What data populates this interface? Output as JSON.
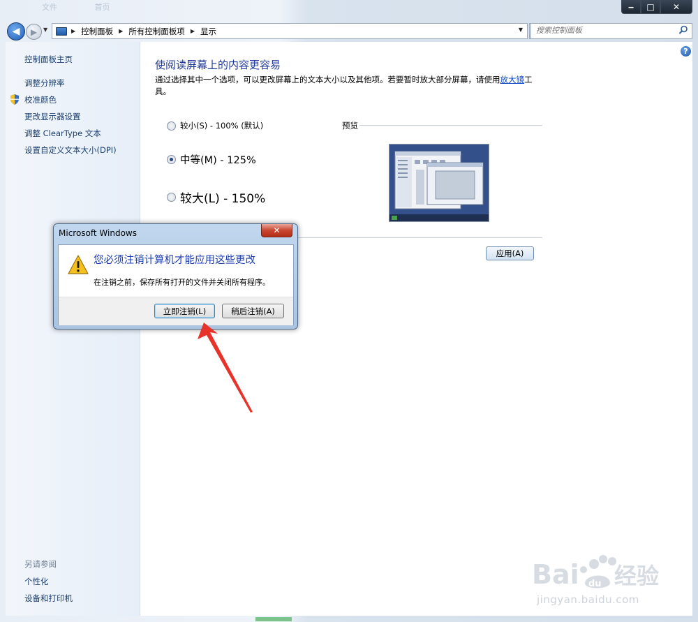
{
  "titlebar": {
    "faded_tabs": [
      "文件",
      "首页"
    ],
    "minimize": "‒",
    "maximize": "□",
    "close": "✕"
  },
  "nav": {
    "back_icon": "arrow-left-icon",
    "forward_icon": "arrow-right-icon",
    "breadcrumb": [
      "控制面板",
      "所有控制面板项",
      "显示"
    ],
    "search_placeholder": "搜索控制面板"
  },
  "sidebar": {
    "home": "控制面板主页",
    "items": [
      "调整分辨率",
      "校准颜色",
      "更改显示器设置",
      "调整 ClearType 文本",
      "设置自定义文本大小(DPI)"
    ],
    "see_also_title": "另请参阅",
    "see_also": [
      "个性化",
      "设备和打印机"
    ]
  },
  "main": {
    "heading": "使阅读屏幕上的内容更容易",
    "description_before": "通过选择其中一个选项，可以更改屏幕上的文本大小以及其他项。若要暂时放大部分屏幕，请使用",
    "description_link": "放大镜",
    "description_after": "工具。",
    "options": [
      {
        "label": "较小(S) - 100% (默认)",
        "checked": false
      },
      {
        "label": "中等(M) - 125%",
        "checked": true
      },
      {
        "label": "较大(L) - 150%",
        "checked": false
      }
    ],
    "preview_label": "预览",
    "apply_button": "应用(A)"
  },
  "dialog": {
    "title": "Microsoft Windows",
    "close": "✕",
    "icon": "warning-icon",
    "main_instruction": "您必须注销计算机才能应用这些更改",
    "content": "在注销之前，保存所有打开的文件并关闭所有程序。",
    "buttons": {
      "logoff_now": "立即注销(L)",
      "logoff_later": "稍后注销(A)"
    }
  },
  "annotation": {
    "arrow_color": "#e8332a"
  },
  "watermark": {
    "text": "jingyan.baidu.com",
    "brand": "Baidu经验"
  }
}
